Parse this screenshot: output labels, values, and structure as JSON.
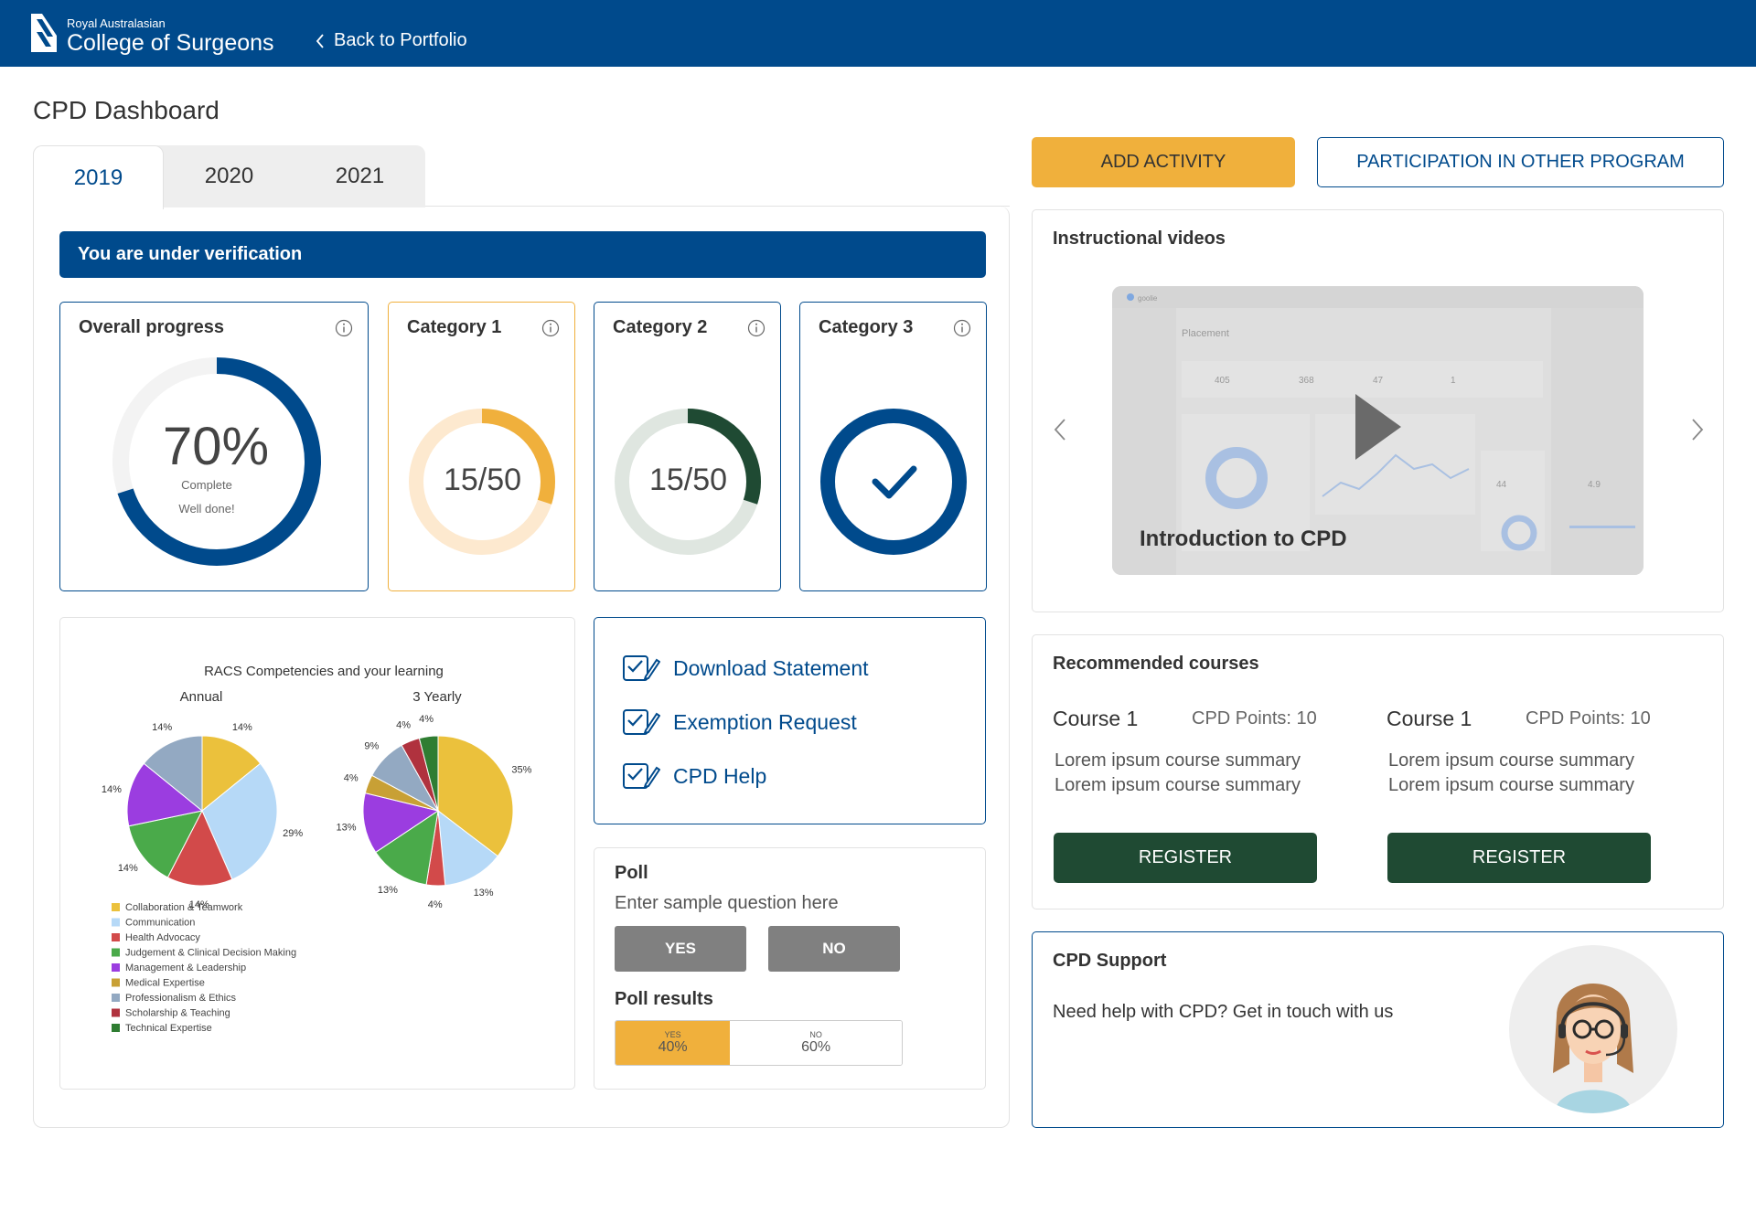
{
  "header": {
    "org_line1": "Royal Australasian",
    "org_line2": "College of Surgeons",
    "back_label": "Back to Portfolio",
    "bg_color": "#004a8c"
  },
  "page_title": "CPD Dashboard",
  "tabs": [
    {
      "label": "2019",
      "active": true
    },
    {
      "label": "2020",
      "active": false
    },
    {
      "label": "2021",
      "active": false
    }
  ],
  "banner": "You are under verification",
  "progress_cards": {
    "overall": {
      "title": "Overall progress",
      "value": "70%",
      "sub1": "Complete",
      "sub2": "Well done!",
      "fraction": 0.7,
      "color": "#004a8c"
    },
    "cat1": {
      "title": "Category 1",
      "value": "15/50",
      "fraction": 0.3,
      "color": "#f0b03c",
      "track": "#fde9cf"
    },
    "cat2": {
      "title": "Category 2",
      "value": "15/50",
      "fraction": 0.3,
      "color": "#1f4a33",
      "track": "#dfe6e0"
    },
    "cat3": {
      "title": "Category 3",
      "complete": true,
      "color": "#004a8c"
    }
  },
  "chart_data": [
    {
      "type": "pie",
      "title": "RACS Competencies and your learning",
      "subtitle": "Annual",
      "labels": [
        "Collaboration & Teamwork",
        "Communication",
        "Health Advocacy",
        "Judgement & Clinical Decision Making",
        "Management & Leadership",
        "Professionalism & Ethics"
      ],
      "values": [
        14,
        29,
        14,
        14,
        14,
        14
      ],
      "value_labels": [
        "14%",
        "29%",
        "14%",
        "14%",
        "14%",
        "14%"
      ],
      "colors": [
        "#ebc13c",
        "#b6d9f7",
        "#d24a4a",
        "#4aaa4a",
        "#9b3de0",
        "#93a9c2"
      ]
    },
    {
      "type": "pie",
      "subtitle": "3 Yearly",
      "labels": [
        "Collaboration & Teamwork",
        "Communication",
        "Health Advocacy",
        "Judgement & Clinical Decision Making",
        "Management & Leadership",
        "Medical Expertise",
        "Professionalism & Ethics",
        "Scholarship & Teaching",
        "Technical Expertise"
      ],
      "values": [
        35,
        13,
        4,
        13,
        13,
        4,
        9,
        4,
        4
      ],
      "value_labels": [
        "35%",
        "13%",
        "4%",
        "13%",
        "13%",
        "4%",
        "9%",
        "4%",
        "4%"
      ],
      "colors": [
        "#ebc13c",
        "#b6d9f7",
        "#d24a4a",
        "#4aaa4a",
        "#9b3de0",
        "#c8a035",
        "#93a9c2",
        "#b0323e",
        "#2f7d32"
      ]
    }
  ],
  "legend": [
    {
      "label": "Collaboration & Teamwork",
      "color": "#ebc13c"
    },
    {
      "label": "Communication",
      "color": "#b6d9f7"
    },
    {
      "label": "Health Advocacy",
      "color": "#d24a4a"
    },
    {
      "label": "Judgement & Clinical Decision Making",
      "color": "#4aaa4a"
    },
    {
      "label": "Management & Leadership",
      "color": "#9b3de0"
    },
    {
      "label": "Medical Expertise",
      "color": "#c8a035"
    },
    {
      "label": "Professionalism & Ethics",
      "color": "#93a9c2"
    },
    {
      "label": "Scholarship & Teaching",
      "color": "#b0323e"
    },
    {
      "label": "Technical Expertise",
      "color": "#2f7d32"
    }
  ],
  "links": [
    {
      "label": "Download Statement",
      "icon": "checklist-edit-icon"
    },
    {
      "label": "Exemption Request",
      "icon": "checklist-edit-icon"
    },
    {
      "label": "CPD Help",
      "icon": "checklist-edit-icon"
    }
  ],
  "poll": {
    "title": "Poll",
    "question": "Enter sample question here",
    "yes_label": "YES",
    "no_label": "NO",
    "results_title": "Poll results",
    "yes_result_label": "YES",
    "no_result_label": "NO",
    "yes_pct": "40%",
    "no_pct": "60%",
    "yes_fraction": 0.4
  },
  "actions": {
    "add_activity": "ADD ACTIVITY",
    "participation": "PARTICIPATION IN OTHER PROGRAM"
  },
  "videos": {
    "title": "Instructional videos",
    "caption": "Introduction to CPD",
    "thumb": {
      "brand": "goolie",
      "section": "Placement",
      "stats": [
        "405",
        "368",
        "47",
        "1"
      ],
      "ratings": [
        "44",
        "4.9"
      ]
    }
  },
  "courses": {
    "title": "Recommended courses",
    "items": [
      {
        "name": "Course 1",
        "points": "CPD Points: 10",
        "summary1": "Lorem ipsum course summary",
        "summary2": "Lorem ipsum course summary",
        "button": "REGISTER"
      },
      {
        "name": "Course 1",
        "points": "CPD Points: 10",
        "summary1": "Lorem ipsum course summary",
        "summary2": "Lorem ipsum course summary",
        "button": "REGISTER"
      }
    ]
  },
  "support": {
    "title": "CPD Support",
    "text": "Need help with CPD? Get in touch with us"
  }
}
